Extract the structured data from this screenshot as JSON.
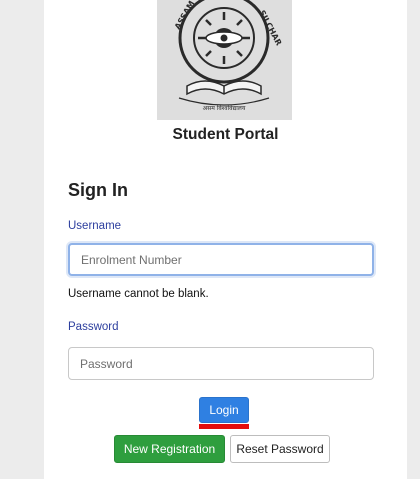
{
  "logo": {
    "alt": "Assam University Silchar emblem",
    "text_left": "ASSAM UN",
    "text_right": "SILCHAR",
    "text_bottom": "असम विश्वविद्यालय"
  },
  "portal": {
    "title": "Student Portal"
  },
  "signin": {
    "heading": "Sign In",
    "username_label": "Username",
    "username_placeholder": "Enrolment Number",
    "username_value": "",
    "username_error": "Username cannot be blank.",
    "password_label": "Password",
    "password_placeholder": "Password",
    "password_value": ""
  },
  "buttons": {
    "login": "Login",
    "new_registration": "New Registration",
    "reset_password": "Reset Password"
  },
  "colors": {
    "link_label": "#2c3e9e",
    "login_button": "#2f80e2",
    "register_button": "#2e9e3e",
    "underline_mark": "#e30d0d",
    "focus_border": "#8fb2e8"
  }
}
